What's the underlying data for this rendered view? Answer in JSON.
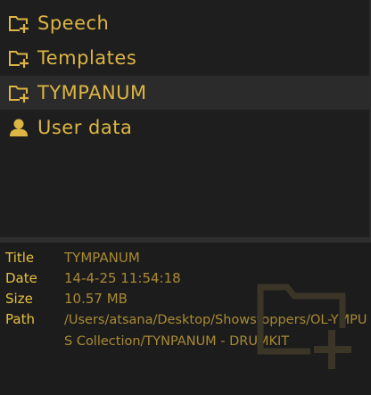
{
  "colors": {
    "accent": "#dcb544",
    "value_text": "#a98a34",
    "background": "#1e1e1e",
    "selected_row": "#2b2b2b"
  },
  "browser": {
    "items": [
      {
        "label": "Speech",
        "icon": "folder-add-icon",
        "selected": false
      },
      {
        "label": "Templates",
        "icon": "folder-add-icon",
        "selected": false
      },
      {
        "label": "TYMPANUM",
        "icon": "folder-add-icon",
        "selected": true
      },
      {
        "label": "User data",
        "icon": "user-icon",
        "selected": false
      }
    ]
  },
  "info": {
    "title_key": "Title",
    "title_value": "TYMPANUM",
    "date_key": "Date",
    "date_value": "14-4-25 11:54:18",
    "size_key": "Size",
    "size_value": "10.57 MB",
    "path_key": "Path",
    "path_value": "/Users/atsana/Desktop/Showstoppers/OL-YMPUS Collection/TYNPANUM - DRUMKIT",
    "watermark_icon": "folder-add-icon"
  }
}
